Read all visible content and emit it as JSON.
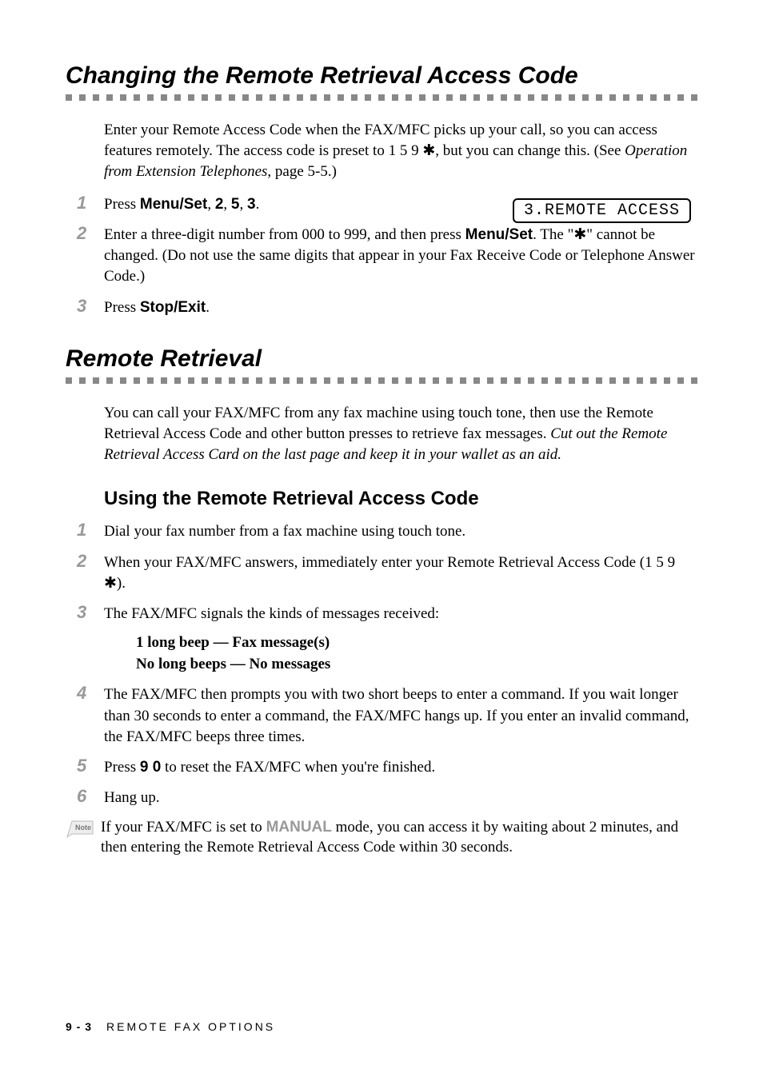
{
  "section1": {
    "heading": "Changing the Remote Retrieval Access Code",
    "intro_part1": "Enter your Remote Access Code when the FAX/MFC picks up your call, so you can access features remotely.  The access code is preset to 1 5 9 ",
    "intro_star": "✱",
    "intro_part2": ", but you can change this. (See ",
    "intro_ref": "Operation from Extension Telephones",
    "intro_part3": ", page 5-5.)",
    "steps": [
      {
        "num": "1",
        "parts": [
          "Press ",
          "Menu/Set",
          ", ",
          "2",
          ", ",
          "5",
          ", ",
          "3",
          "."
        ]
      },
      {
        "num": "2",
        "parts": [
          "Enter a three-digit number from 000 to 999, and then press ",
          "Menu/Set",
          ". The \"",
          "✱",
          "\" cannot be changed. (Do not use the same digits that appear in your Fax Receive Code or Telephone Answer Code.)"
        ]
      },
      {
        "num": "3",
        "parts": [
          "Press ",
          "Stop/Exit",
          "."
        ]
      }
    ],
    "display": "3.REMOTE ACCESS"
  },
  "section2": {
    "heading": "Remote Retrieval",
    "intro_part1": "You can call your FAX/MFC from any fax machine using touch tone, then use the Remote Retrieval Access Code and other button presses to retrieve fax messages. ",
    "intro_italic": "Cut out the Remote Retrieval Access Card on the last page and keep it in your wallet as an aid.",
    "subheading": "Using the Remote Retrieval Access Code",
    "steps": [
      {
        "num": "1",
        "text": "Dial your fax number from a fax machine using touch tone."
      },
      {
        "num": "2",
        "text_pre": "When your FAX/MFC answers, immediately enter your Remote Retrieval Access Code (1 5 9 ",
        "star": "✱",
        "text_post": ")."
      },
      {
        "num": "3",
        "text": "The FAX/MFC signals the kinds of messages received:"
      },
      {
        "num": "4",
        "text": "The FAX/MFC then prompts you with two short beeps to enter a command.  If you wait longer than 30 seconds to enter a command, the FAX/MFC hangs up. If you enter an invalid command, the FAX/MFC beeps three times."
      },
      {
        "num": "5",
        "text_pre": "Press ",
        "bold": "9 0",
        "text_post": " to reset the FAX/MFC when you're finished."
      },
      {
        "num": "6",
        "text": "Hang up."
      }
    ],
    "beep1": "1 long beep — Fax message(s)",
    "beep2": "No long beeps — No messages",
    "note_pre": "If your FAX/MFC is set to ",
    "note_manual": "MANUAL",
    "note_post": " mode, you can access it by waiting about 2 minutes, and then entering the Remote Retrieval Access Code within 30 seconds."
  },
  "footer": {
    "page": "9 - 3",
    "chapter": "REMOTE FAX OPTIONS"
  }
}
